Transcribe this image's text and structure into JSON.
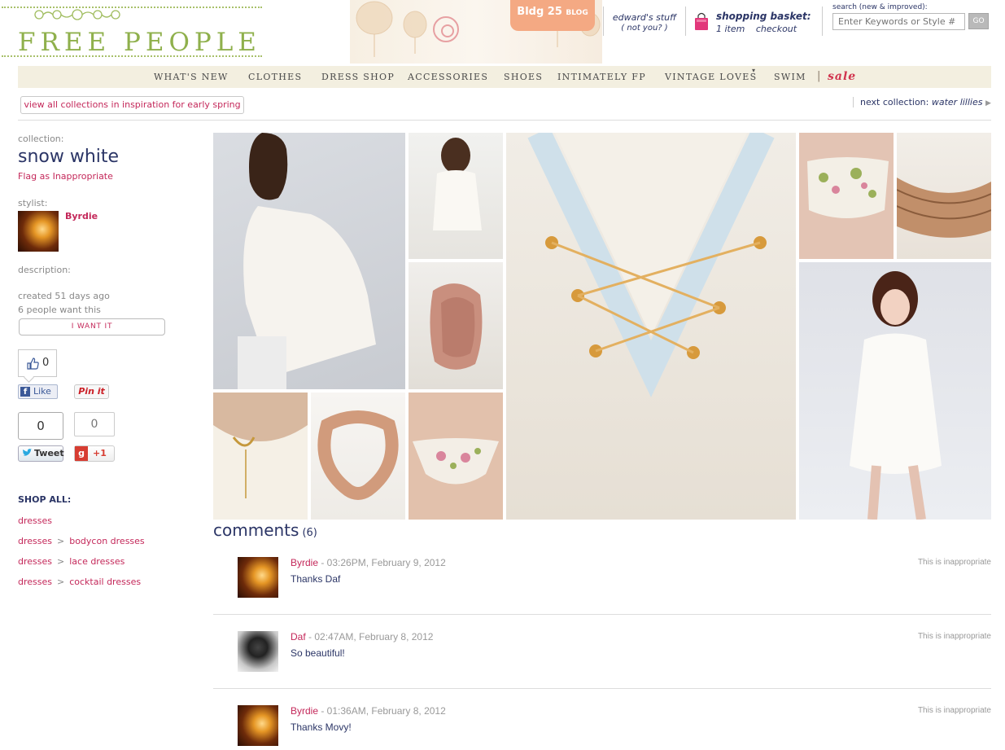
{
  "header": {
    "logo": "FREE PEOPLE",
    "blog_tag": "Bldg 25",
    "blog_tag_small": "BLOG",
    "user_name": "edward's stuff",
    "user_switch": "( not you? )",
    "basket_title": "shopping basket:",
    "basket_items": "1 item",
    "basket_checkout": "checkout",
    "search_label": "search (new & improved):",
    "search_placeholder": "Enter Keywords or Style #",
    "go_label": "GO"
  },
  "nav": {
    "items": [
      "WHAT'S NEW",
      "CLOTHES",
      "DRESS SHOP",
      "ACCESSORIES",
      "SHOES",
      "INTIMATELY FP",
      "VINTAGE LOVES",
      "SWIM"
    ],
    "separator": "|",
    "sale": "sale"
  },
  "collection_bar": {
    "view_all": "view all collections in inspiration for early spring",
    "next_label": "next collection:",
    "next_name": "water lillies"
  },
  "sidebar": {
    "collection_label": "collection:",
    "collection_name": "snow white",
    "flag": "Flag as Inappropriate",
    "stylist_label": "stylist:",
    "stylist_name": "Byrdie",
    "description_label": "description:",
    "created": "created 51 days ago",
    "want_count": "6 people want this",
    "want_button": "I WANT IT",
    "like_count": "0",
    "fb_like": "Like",
    "pin_it": "Pin it",
    "tweet_count": "0",
    "gplus_count": "0",
    "tweet": "Tweet",
    "gplus": "+1",
    "shop_all": "SHOP ALL:",
    "categories": [
      [
        "dresses"
      ],
      [
        "dresses",
        "bodycon dresses"
      ],
      [
        "dresses",
        "lace dresses"
      ],
      [
        "dresses",
        "cocktail dresses"
      ]
    ]
  },
  "comments": {
    "title": "comments",
    "count": "(6)",
    "items": [
      {
        "name": "Byrdie",
        "meta": " - 03:26PM, February 9, 2012",
        "text": "Thanks Daf",
        "flag": "This is inappropriate"
      },
      {
        "name": "Daf",
        "meta": " - 02:47AM, February 8, 2012",
        "text": "So beautiful!",
        "flag": "This is inappropriate"
      },
      {
        "name": "Byrdie",
        "meta": " - 01:36AM, February 8, 2012",
        "text": "Thanks Movy!",
        "flag": "This is inappropriate"
      }
    ]
  },
  "colors": {
    "accent_pink": "#c4285a",
    "navy": "#2b3566",
    "logo_green": "#8fb04c",
    "nav_bg": "#f3efe0",
    "sale_red": "#d1344e"
  }
}
